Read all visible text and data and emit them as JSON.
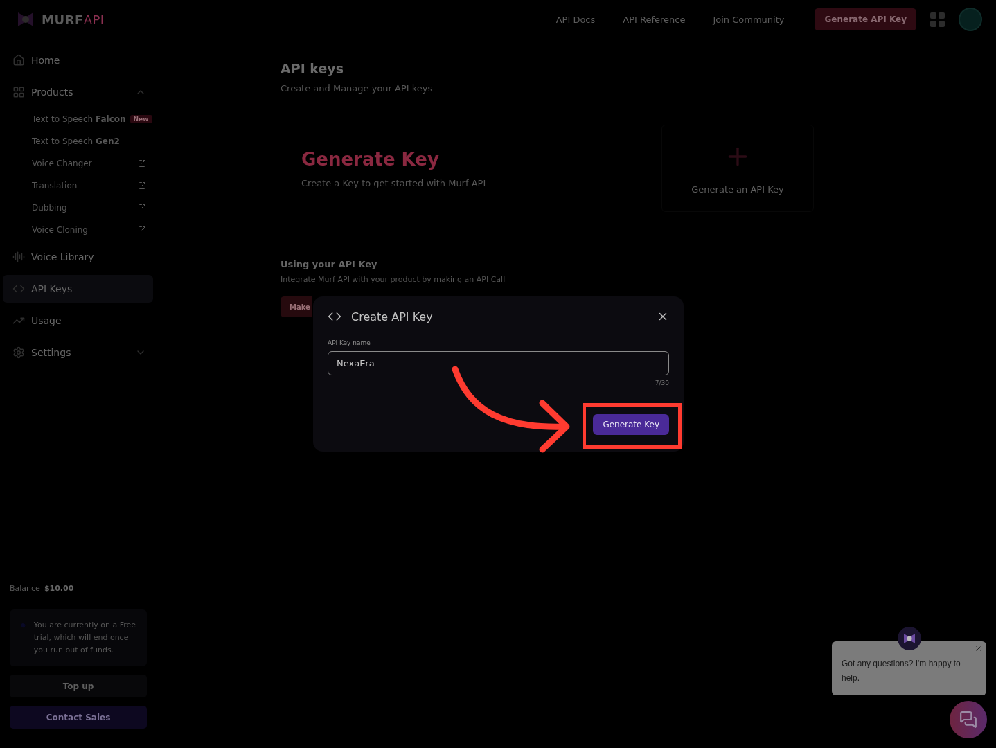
{
  "header": {
    "logo": {
      "word": "MURF",
      "accent": "API"
    },
    "links": [
      "API Docs",
      "API Reference",
      "Join Community"
    ],
    "cta": "Generate API Key"
  },
  "sidebar": {
    "items": [
      {
        "kind": "item",
        "label": "Home",
        "selected": false
      },
      {
        "kind": "group",
        "label": "Products",
        "selected": false,
        "expanded": true,
        "children": [
          {
            "label": "Text to Speech **Falcon**",
            "badge": "New",
            "external": false
          },
          {
            "label": "Text to Speech **Gen2**",
            "external": false
          },
          {
            "label": "Voice Changer",
            "external": true
          },
          {
            "label": "Translation",
            "external": true
          },
          {
            "label": "Dubbing",
            "external": true
          },
          {
            "label": "Voice Cloning",
            "external": true
          }
        ]
      },
      {
        "kind": "item",
        "label": "Voice Library",
        "selected": false
      },
      {
        "kind": "item",
        "label": "API Keys",
        "selected": true
      },
      {
        "kind": "item",
        "label": "Usage",
        "selected": false
      },
      {
        "kind": "group",
        "label": "Settings",
        "selected": false,
        "expanded": false
      }
    ],
    "balance": {
      "label": "Balance",
      "value": "$10.00"
    },
    "notice": "You are currently on a Free trial, which will end once you run out of funds.",
    "buttons": [
      {
        "label": "Top up",
        "kind": "secondary"
      },
      {
        "label": "Contact Sales",
        "kind": "primary"
      }
    ]
  },
  "main": {
    "title": "API keys",
    "subtitle": "Create and Manage your API keys",
    "hero": {
      "title": "Generate Key",
      "subtitle": "Create a Key to get started with Murf API"
    },
    "add_card": {
      "label": "Generate an API Key"
    },
    "usage": {
      "title": "Using your API Key",
      "text": "Integrate Murf API with your product by making an API Call",
      "button": "Make"
    }
  },
  "modal": {
    "title": "Create API Key",
    "field_label": "API Key name",
    "value": "NexaEra",
    "counter": "7/30",
    "button": "Generate Key"
  },
  "chat": {
    "message": "Got any questions? I'm happy to help."
  }
}
